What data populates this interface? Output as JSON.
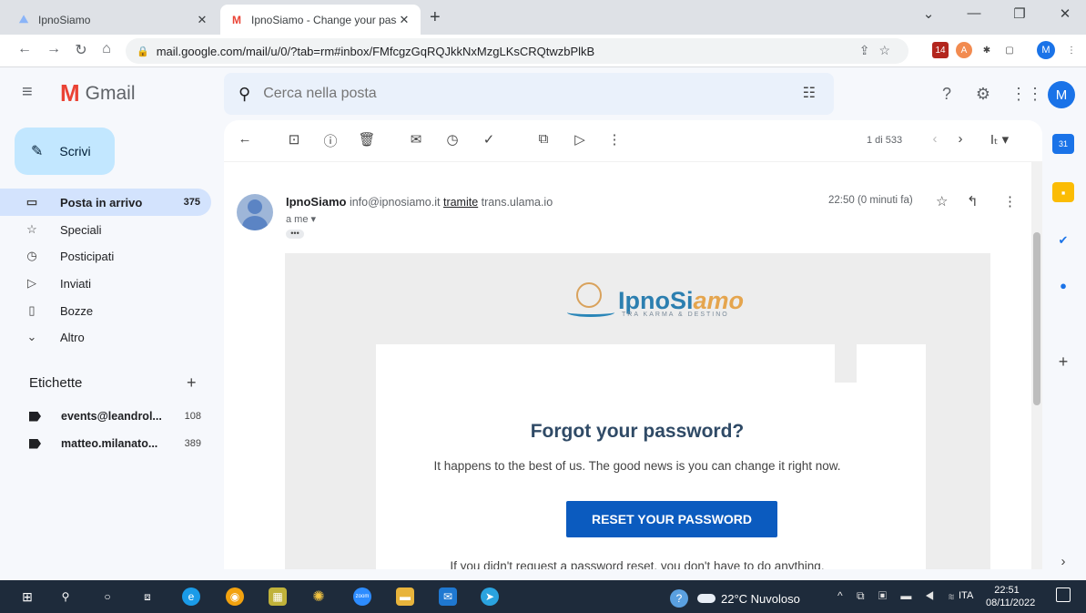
{
  "browser": {
    "tabs": [
      {
        "title": "IpnoSiamo",
        "close": "✕"
      },
      {
        "title": "IpnoSiamo - Change your passw",
        "close": "✕"
      }
    ],
    "new_tab": "+",
    "url": "mail.google.com/mail/u/0/?tab=rm#inbox/FMfcgzGqRQJkkNxMzgLKsCRQtwzbPlkB",
    "extension_badge": "14",
    "profile_initial": "M"
  },
  "gmail": {
    "app_name": "Gmail",
    "search_placeholder": "Cerca nella posta",
    "avatar_initial": "M"
  },
  "sidebar": {
    "compose_label": "Scrivi",
    "items": [
      {
        "label": "Posta in arrivo",
        "count": "375",
        "icon": "inbox-icon"
      },
      {
        "label": "Speciali",
        "count": "",
        "icon": "star-icon"
      },
      {
        "label": "Posticipati",
        "count": "",
        "icon": "clock-icon"
      },
      {
        "label": "Inviati",
        "count": "",
        "icon": "send-icon"
      },
      {
        "label": "Bozze",
        "count": "",
        "icon": "draft-icon"
      },
      {
        "label": "Altro",
        "count": "",
        "icon": "chevron-down-icon"
      }
    ],
    "labels_heading": "Etichette",
    "labels": [
      {
        "label": "events@leandrol...",
        "count": "108"
      },
      {
        "label": "matteo.milanato...",
        "count": "389"
      }
    ]
  },
  "toolbar": {
    "pager": "1 di 533"
  },
  "message": {
    "sender_name": "IpnoSiamo",
    "sender_email": "info@ipnosiamo.it",
    "via_label": "tramite",
    "via_domain": "trans.ulama.io",
    "to": "a me ▾",
    "time": "22:50 (0 minuti fa)"
  },
  "email": {
    "brand_main": "IpnoSi",
    "brand_accent": "amo",
    "brand_tagline": "TRA KARMA & DESTINO",
    "heading": "Forgot your password?",
    "body": "It happens to the best of us. The good news is you can change it right now.",
    "button": "RESET YOUR PASSWORD",
    "footer": "If you didn't request a password reset, you don't have to do anything."
  },
  "taskbar": {
    "weather": "22°C Nuvoloso",
    "lang": "ITA",
    "time": "22:51",
    "date": "08/11/2022"
  },
  "colors": {
    "accent": "#0b5bbf",
    "compose": "#c2e7ff",
    "selected": "#d3e3fd",
    "taskbar": "#1e2b3b"
  }
}
